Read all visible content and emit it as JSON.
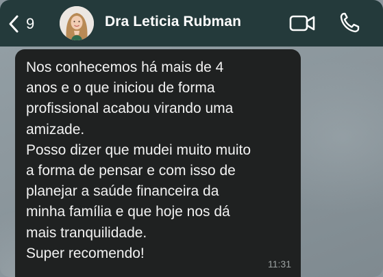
{
  "header": {
    "back_count": "9",
    "contact_name": "Dra Leticia Rubman",
    "background": "#243a3b"
  },
  "icons": {
    "back": "chevron-left-icon",
    "video": "video-camera-icon",
    "call": "phone-icon"
  },
  "message": {
    "lines": [
      "Nos conhecemos há mais de 4",
      "anos e o que iniciou de forma",
      "profissional acabou virando uma",
      "amizade.",
      "Posso dizer que mudei muito muito",
      "a forma de pensar e com isso de",
      "planejar a saúde financeira da",
      "minha família e que hoje nos dá",
      "mais tranquilidade.",
      "Super recomendo!"
    ],
    "time": "11:31",
    "bubble_color": "#1f2121"
  }
}
